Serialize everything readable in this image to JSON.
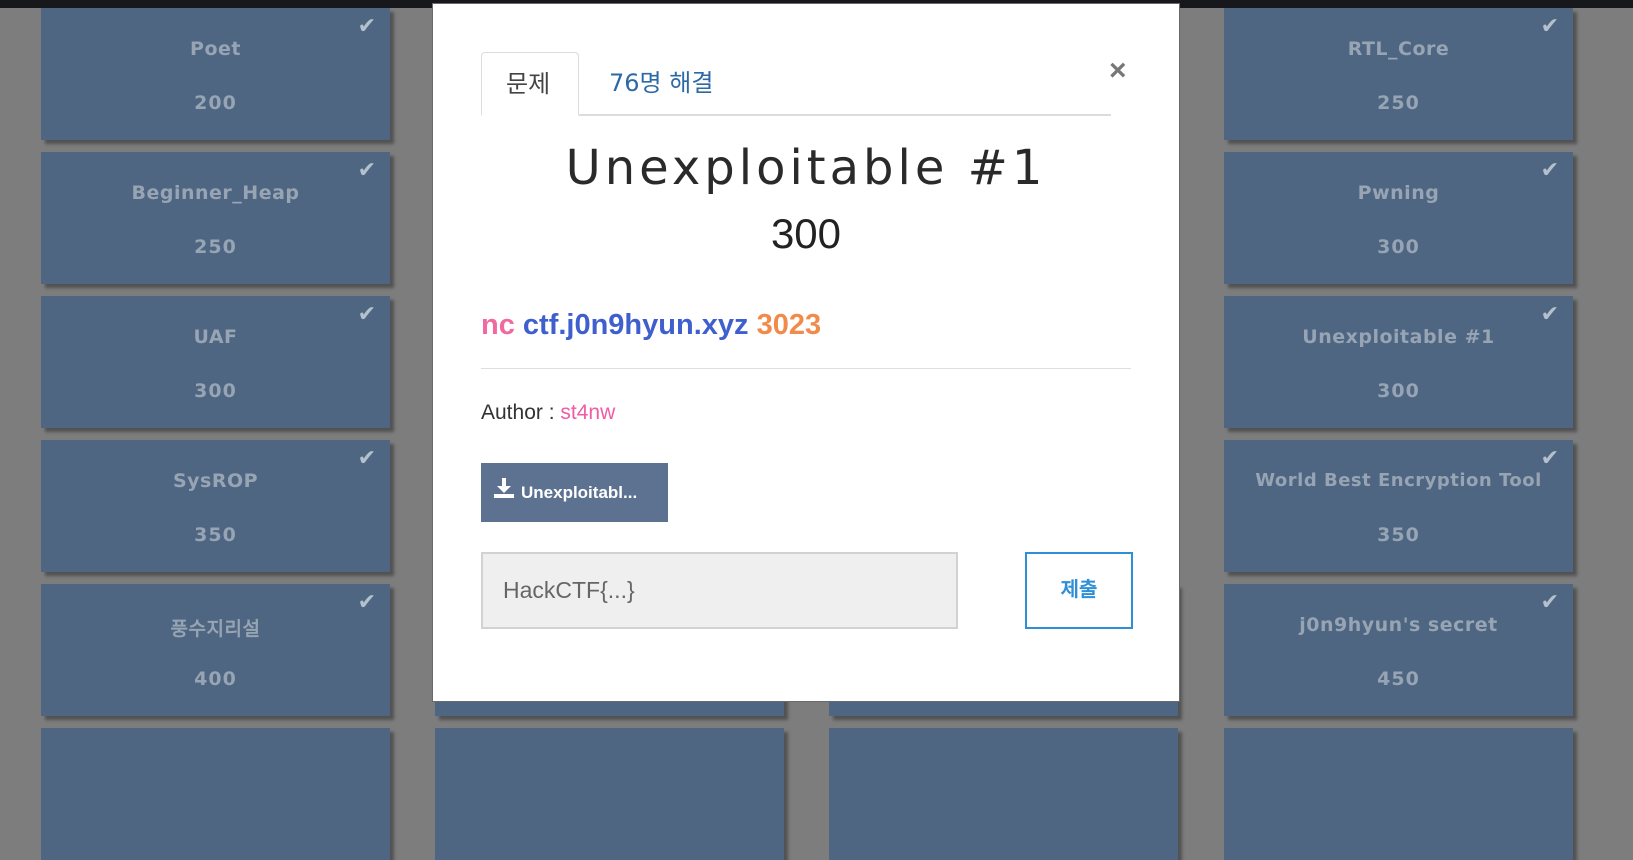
{
  "board": {
    "columns": [
      {
        "cards": [
          {
            "name": "Poet",
            "points": "200"
          },
          {
            "name": "Beginner_Heap",
            "points": "250"
          },
          {
            "name": "UAF",
            "points": "300"
          },
          {
            "name": "SysROP",
            "points": "350"
          },
          {
            "name": "풍수지리설",
            "points": "400"
          }
        ]
      },
      {
        "cards": [
          {
            "name": "RTL_Core",
            "points": "250"
          },
          {
            "name": "Pwning",
            "points": "300"
          },
          {
            "name": "Unexploitable #1",
            "points": "300"
          },
          {
            "name": "World Best Encryption Tool",
            "points": "350"
          },
          {
            "name": "j0n9hyun's secret",
            "points": "450"
          }
        ]
      }
    ],
    "solved_icon": "check-icon"
  },
  "modal": {
    "tabs": [
      {
        "label": "문제"
      },
      {
        "label": "76명 해결"
      }
    ],
    "close_label": "×",
    "title": "Unexploitable #1",
    "points": "300",
    "connection": {
      "nc": "nc",
      "host": "ctf.j0n9hyun.xyz",
      "port": "3023"
    },
    "author_label": "Author :",
    "author": "st4nw",
    "download_label": "Unexploitabl...",
    "flag_placeholder": "HackCTF{...}",
    "submit_label": "제출"
  },
  "colors": {
    "card_bg": "#4f6682",
    "nc": "#f06aa0",
    "host": "#3f5fcf",
    "port": "#f28a4c",
    "author": "#ef5ca6",
    "submit": "#2f8fd6"
  }
}
